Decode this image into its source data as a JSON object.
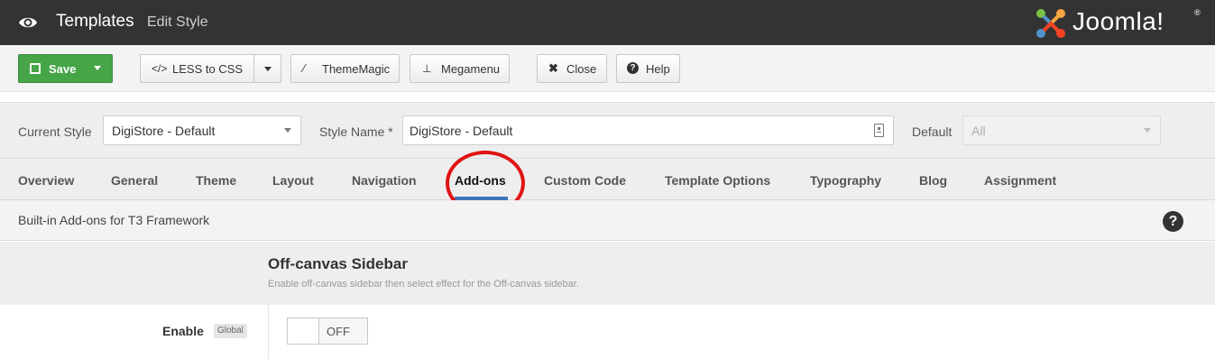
{
  "header": {
    "title": "Templates",
    "subtitle": "Edit Style",
    "brand": "Joomla!",
    "brand_registered": "®"
  },
  "toolbar": {
    "save_label": "Save",
    "less_label": "LESS to CSS",
    "thememagic_label": "ThemeMagic",
    "megamenu_label": "Megamenu",
    "close_label": "Close",
    "help_label": "Help"
  },
  "style_form": {
    "current_style_label": "Current Style",
    "current_style_value": "DigiStore - Default",
    "style_name_label": "Style Name *",
    "style_name_value": "DigiStore - Default",
    "default_label": "Default",
    "default_value": "All"
  },
  "tabs": [
    {
      "label": "Overview"
    },
    {
      "label": "General"
    },
    {
      "label": "Theme"
    },
    {
      "label": "Layout"
    },
    {
      "label": "Navigation"
    },
    {
      "label": "Add-ons"
    },
    {
      "label": "Custom Code"
    },
    {
      "label": "Template Options"
    },
    {
      "label": "Typography"
    },
    {
      "label": "Blog"
    },
    {
      "label": "Assignment"
    }
  ],
  "active_tab": "Add-ons",
  "info": {
    "text": "Built-in Add-ons for T3 Framework",
    "help_glyph": "?"
  },
  "section": {
    "title": "Off-canvas Sidebar",
    "description": "Enable off-canvas sidebar then select effect for the Off-canvas sidebar."
  },
  "option": {
    "label": "Enable",
    "badge": "Global",
    "toggle_state": "OFF"
  },
  "colors": {
    "header_bg": "#333333",
    "save_green": "#46a546",
    "active_tab_underline": "#3c77b7",
    "annotation_red": "#e01414"
  }
}
